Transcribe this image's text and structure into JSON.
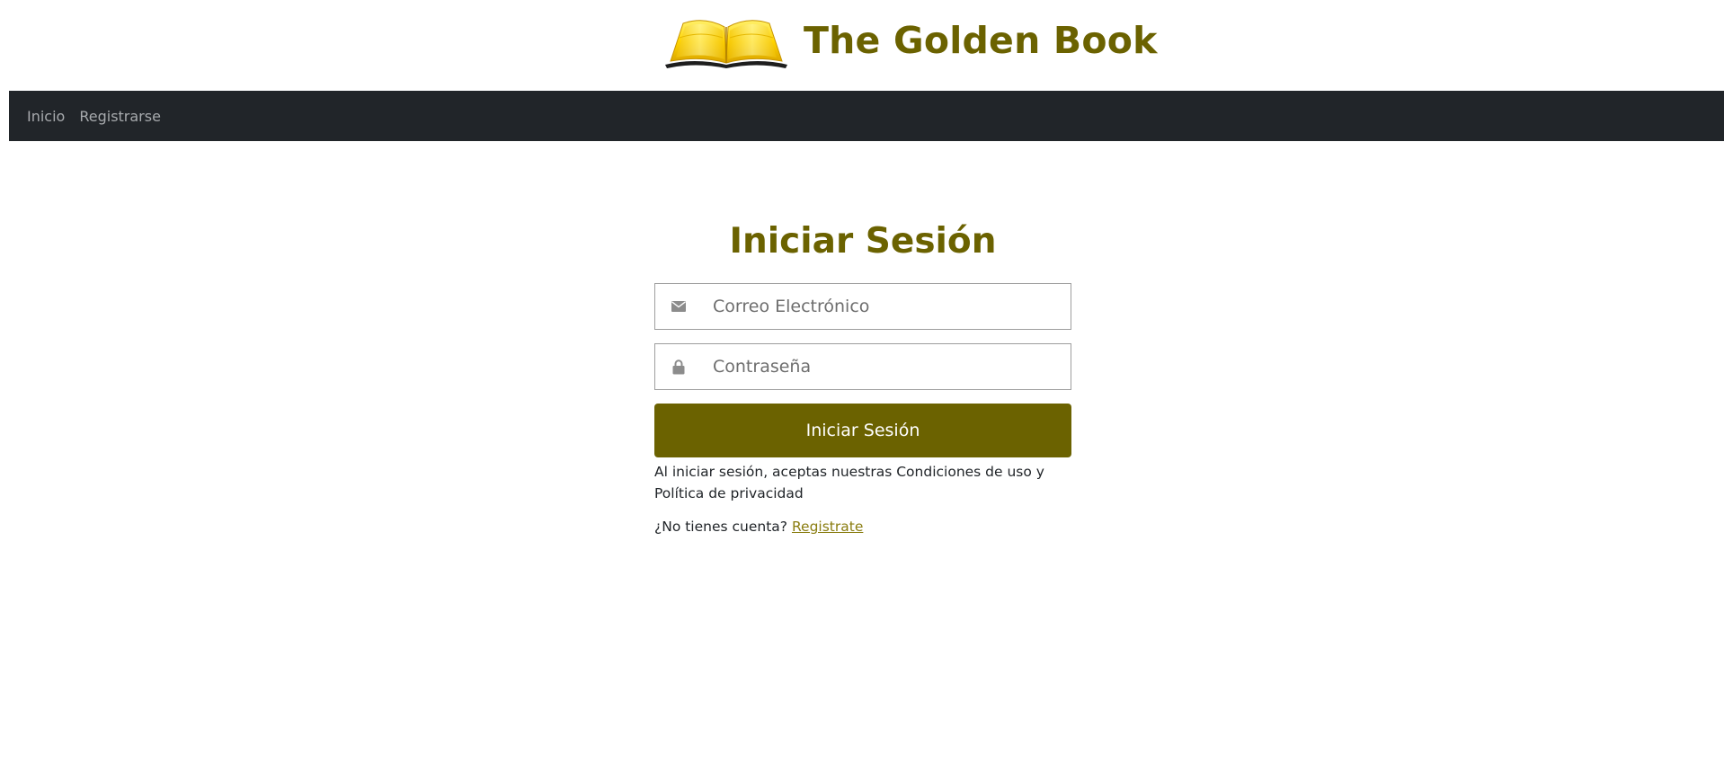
{
  "header": {
    "title": "The Golden Book",
    "logo_icon": "open-book-icon",
    "logo_colors": [
      "#ffd400",
      "#f2b800",
      "#c89400",
      "#1e1e1e"
    ]
  },
  "navbar": {
    "background": "#212529",
    "items": [
      {
        "label": "Inicio"
      },
      {
        "label": "Registrarse"
      }
    ]
  },
  "login": {
    "title": "Iniciar Sesión",
    "email": {
      "icon": "envelope-icon",
      "placeholder": "Correo Electrónico",
      "value": ""
    },
    "password": {
      "icon": "lock-icon",
      "placeholder": "Contraseña",
      "value": ""
    },
    "submit_label": "Iniciar Sesión",
    "terms_text": "Al iniciar sesión, aceptas nuestras Condiciones de uso y Política de privacidad",
    "signup_prompt": "¿No tienes cuenta?",
    "signup_link": "Registrate"
  },
  "colors": {
    "accent": "#6b6200",
    "link": "#8a7d10",
    "nav_text": "#a7aaad"
  }
}
